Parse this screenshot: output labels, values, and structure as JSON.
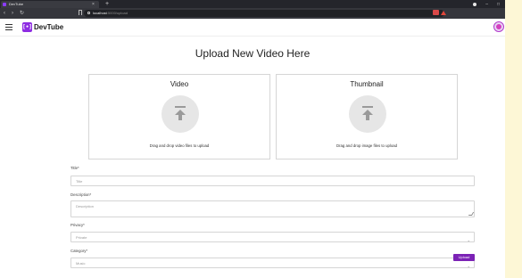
{
  "browser": {
    "tab_title": "DevTube",
    "tab_close": "×",
    "new_tab": "+",
    "back": "‹",
    "forward": "›",
    "reload": "↻",
    "url_host": "localhost",
    "url_path": ":5000/upload",
    "minimize": "–",
    "maximize": "□",
    "close": "×"
  },
  "navbar": {
    "logo_mark": "[•]",
    "logo_text": "DevTube"
  },
  "upload": {
    "title": "Upload New Video Here",
    "video_box_title": "Video",
    "video_hint": "Drag and drop video files to upload",
    "thumb_box_title": "Thumbnail",
    "thumb_hint": "Drag and drop image files to upload"
  },
  "form": {
    "title_label": "Title*",
    "title_placeholder": "Title",
    "description_label": "Description*",
    "description_placeholder": "Description",
    "privacy_label": "Privacy*",
    "privacy_value": "Private",
    "category_label": "Category*",
    "category_value": "Music",
    "submit_label": "Upload"
  },
  "icons": {
    "favicon": "devtube-favicon-icon",
    "menu": "hamburger-menu-icon",
    "upload": "upload-arrow-icon",
    "avatar": "user-avatar-icon"
  },
  "colors": {
    "accent": "#7b22b5",
    "logo": "#8e2de2",
    "background_strip": "#fdf7d6"
  }
}
